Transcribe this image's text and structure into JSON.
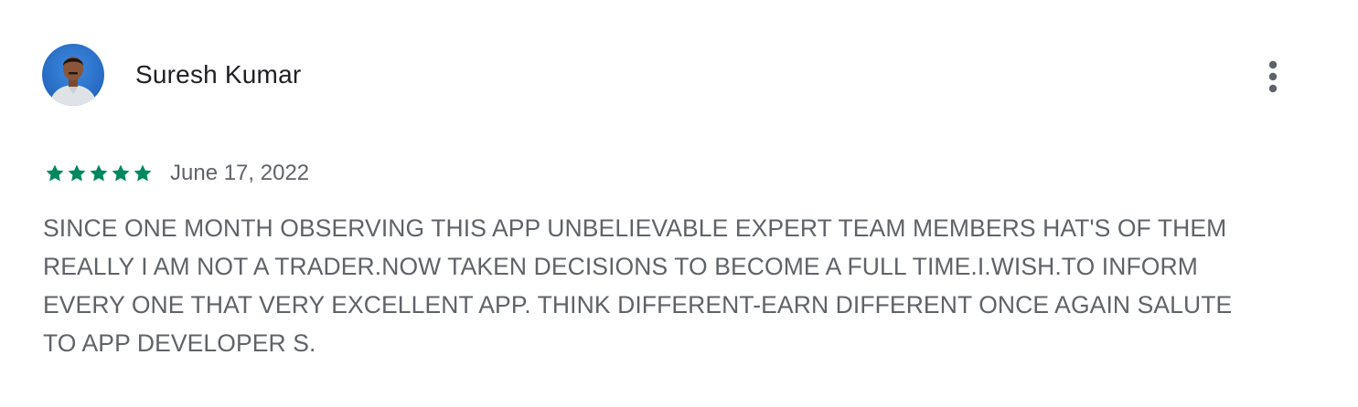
{
  "review": {
    "author": "Suresh Kumar",
    "avatar_icon": "user-photo-avatar",
    "more_icon": "more-vert-icon",
    "rating": 5,
    "rating_max": 5,
    "star_color": "#01875f",
    "date": "June 17, 2022",
    "text": "SINCE ONE MONTH OBSERVING THIS APP UNBELIEVABLE EXPERT TEAM MEMBERS HAT'S OF THEM\nREALLY I AM NOT A TRADER.NOW TAKEN DECISIONS TO BECOME A FULL TIME.I.WISH.TO INFORM\nEVERY ONE THAT VERY EXCELLENT APP. THINK DIFFERENT-EARN DIFFERENT ONCE AGAIN SALUTE\nTO APP DEVELOPER S."
  }
}
